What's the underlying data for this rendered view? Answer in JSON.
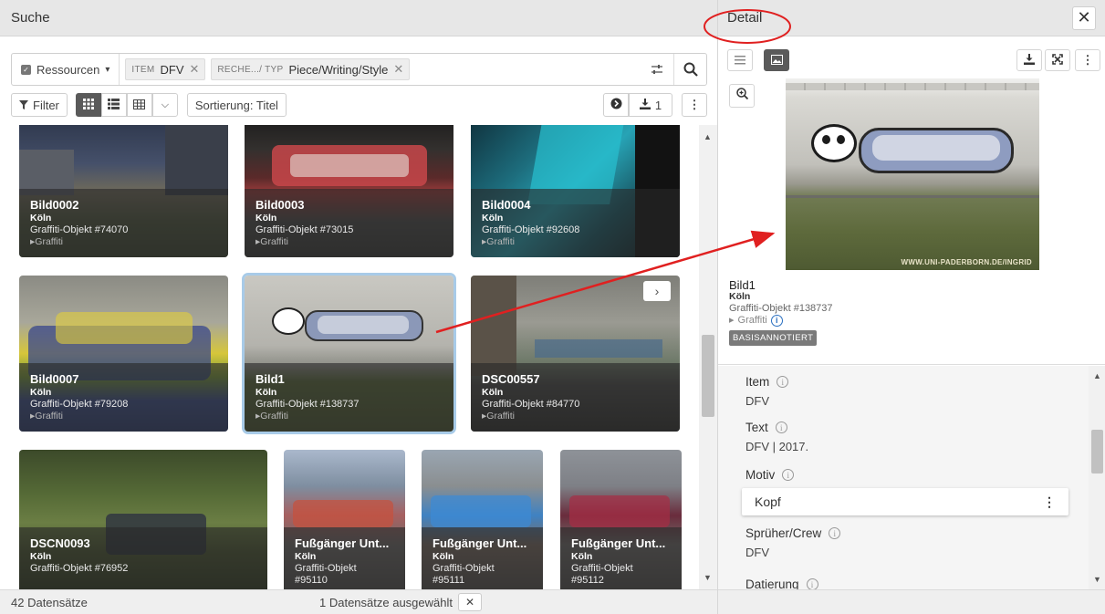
{
  "search": {
    "title": "Suche",
    "resources_label": "Ressourcen",
    "chips": [
      {
        "key": "ITEM",
        "value": "DFV"
      },
      {
        "key": "RECHE.../ TYP",
        "value": "Piece/Writing/Style"
      }
    ],
    "filter_label": "Filter",
    "sort_label": "Sortierung: Titel",
    "download_count": "1"
  },
  "results": [
    {
      "title": "Bild0002",
      "city": "Köln",
      "object": "Graffiti-Objekt #74070",
      "category": "Graffiti"
    },
    {
      "title": "Bild0003",
      "city": "Köln",
      "object": "Graffiti-Objekt #73015",
      "category": "Graffiti"
    },
    {
      "title": "Bild0004",
      "city": "Köln",
      "object": "Graffiti-Objekt #92608",
      "category": "Graffiti"
    },
    {
      "title": "Bild0007",
      "city": "Köln",
      "object": "Graffiti-Objekt #79208",
      "category": "Graffiti"
    },
    {
      "title": "Bild1",
      "city": "Köln",
      "object": "Graffiti-Objekt #138737",
      "category": "Graffiti"
    },
    {
      "title": "DSC00557",
      "city": "Köln",
      "object": "Graffiti-Objekt #84770",
      "category": "Graffiti"
    },
    {
      "title": "DSCN0093",
      "city": "Köln",
      "object": "Graffiti-Objekt #76952",
      "category": ""
    },
    {
      "title": "Fußgänger Unt...",
      "city": "Köln",
      "object": "Graffiti-Objekt",
      "object2": "#95110"
    },
    {
      "title": "Fußgänger Unt...",
      "city": "Köln",
      "object": "Graffiti-Objekt",
      "object2": "#95111"
    },
    {
      "title": "Fußgänger Unt...",
      "city": "Köln",
      "object": "Graffiti-Objekt",
      "object2": "#95112"
    }
  ],
  "status": {
    "count": "42 Datensätze",
    "selected": "1 Datensätze ausgewählt"
  },
  "detail": {
    "title": "Detail",
    "item_title": "Bild1",
    "city": "Köln",
    "object": "Graffiti-Objekt #138737",
    "category": "Graffiti",
    "badge": "BASISANNOTIERT",
    "image_watermark": "WWW.UNI-PADERBORN.DE/INGRID",
    "fields": {
      "item_label": "Item",
      "item_value": "DFV",
      "text_label": "Text",
      "text_value": "DFV | 2017.",
      "motiv_label": "Motiv",
      "motiv_value": "Kopf",
      "crew_label": "Sprüher/Crew",
      "crew_value": "DFV",
      "datierung_label": "Datierung"
    }
  },
  "colors": {
    "annotation_red": "#e02020",
    "selection_blue": "#a8cbe8",
    "active_button": "#5a5a5a"
  }
}
